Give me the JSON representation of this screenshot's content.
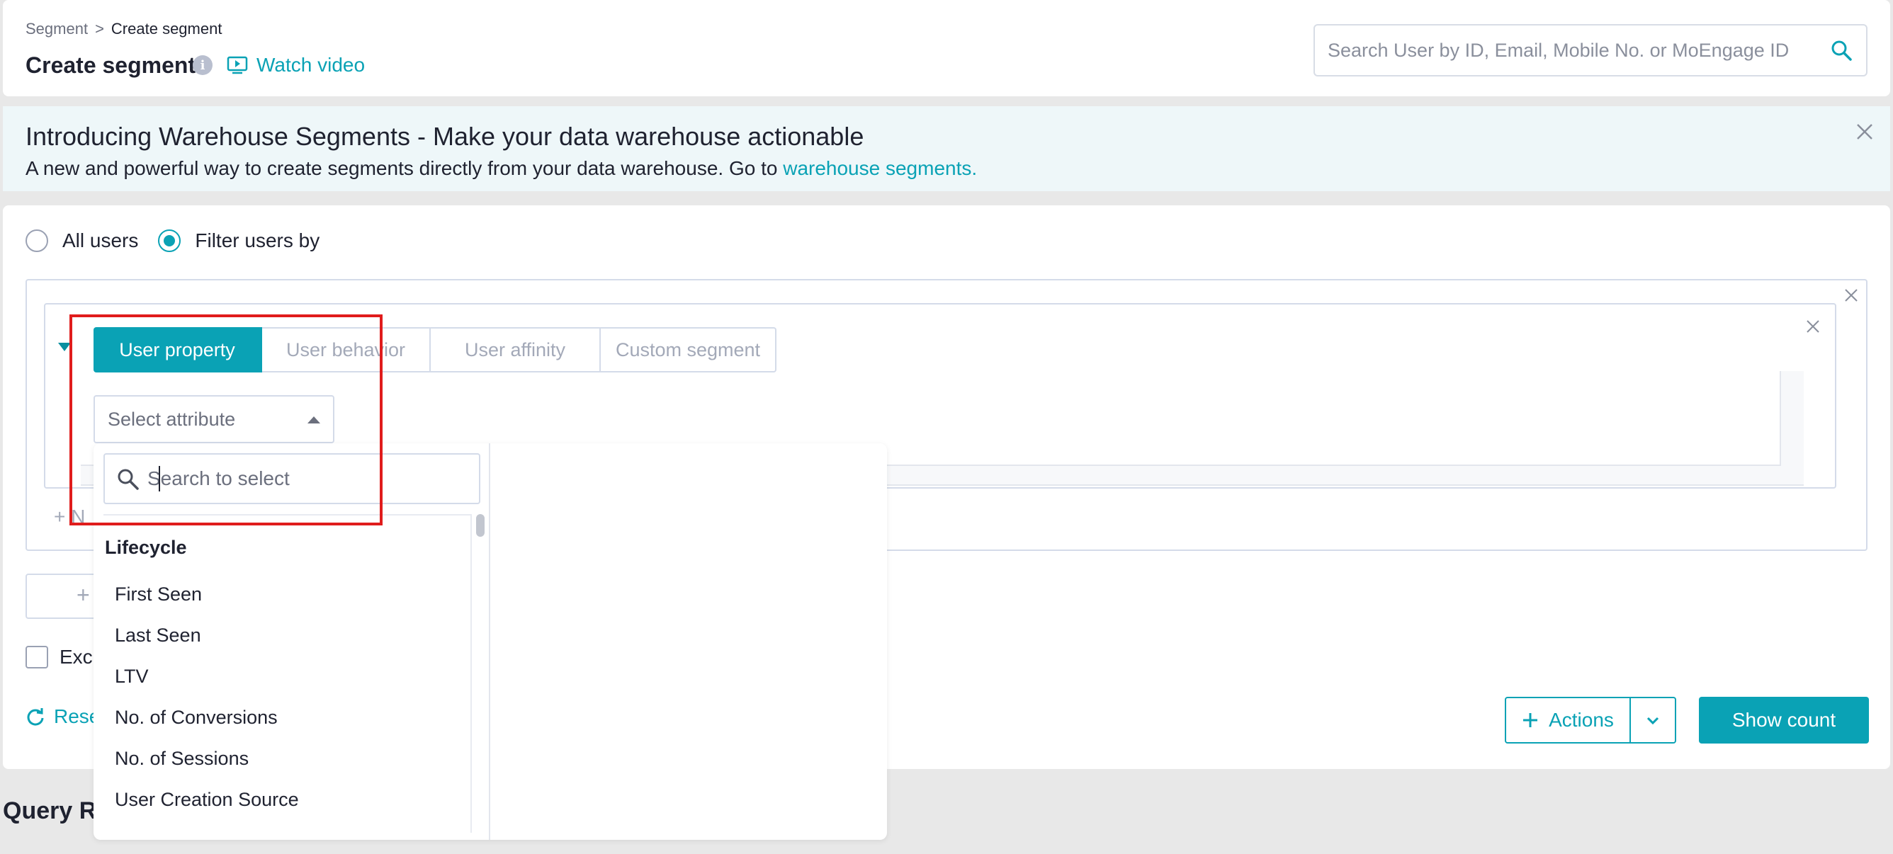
{
  "header": {
    "breadcrumb": {
      "parent": "Segment",
      "separator": ">",
      "current": "Create segment"
    },
    "title": "Create segment",
    "watch_video": "Watch video",
    "search_placeholder": "Search User by ID, Email, Mobile No. or MoEngage ID"
  },
  "banner": {
    "title": "Introducing Warehouse Segments - Make your data warehouse actionable",
    "text": "A new and powerful way to create segments directly from your data warehouse. Go to",
    "link": "warehouse segments."
  },
  "audience": {
    "options": [
      {
        "label": "All users",
        "selected": false
      },
      {
        "label": "Filter users by",
        "selected": true
      }
    ]
  },
  "filter": {
    "tabs": [
      "User property",
      "User behavior",
      "User affinity",
      "Custom segment"
    ],
    "active_tab": "User property",
    "select_placeholder": "Select attribute",
    "add_filter_partial": "+ N",
    "add_button_partial": "+",
    "exclude_partial": "Excl",
    "reset_partial": "Rese"
  },
  "dropdown": {
    "search_placeholder": "Search to select",
    "group": "Lifecycle",
    "options": [
      "First Seen",
      "Last Seen",
      "LTV",
      "No. of Conversions",
      "No. of Sessions",
      "User Creation Source"
    ]
  },
  "footer": {
    "actions": "Actions",
    "show_count": "Show count"
  },
  "query_partial": "Query R",
  "colors": {
    "accent": "#0aa2b5",
    "highlight": "#e01c1c",
    "banner_bg": "#eef7f9"
  }
}
